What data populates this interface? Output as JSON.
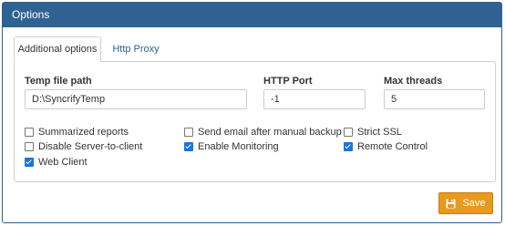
{
  "header": {
    "title": "Options"
  },
  "tabs": [
    {
      "label": "Additional options",
      "active": true
    },
    {
      "label": "Http Proxy",
      "active": false
    }
  ],
  "fields": {
    "temp_path": {
      "label": "Temp file path",
      "value": "D:\\SyncrifyTemp"
    },
    "http_port": {
      "label": "HTTP Port",
      "value": "-1"
    },
    "max_threads": {
      "label": "Max threads",
      "value": "5"
    }
  },
  "checkboxes": [
    {
      "label": "Summarized reports",
      "checked": false
    },
    {
      "label": "Send email after manual backup",
      "checked": false
    },
    {
      "label": "Strict SSL",
      "checked": false
    },
    {
      "label": "Disable Server-to-client",
      "checked": false
    },
    {
      "label": "Enable Monitoring",
      "checked": true
    },
    {
      "label": "Remote Control",
      "checked": true
    },
    {
      "label": "Web Client",
      "checked": true
    }
  ],
  "save_button": {
    "label": "Save",
    "icon": "floppy-disk-icon"
  },
  "colors": {
    "header": "#2f6292",
    "save": "#e89a1f",
    "check": "#1a73e8"
  }
}
